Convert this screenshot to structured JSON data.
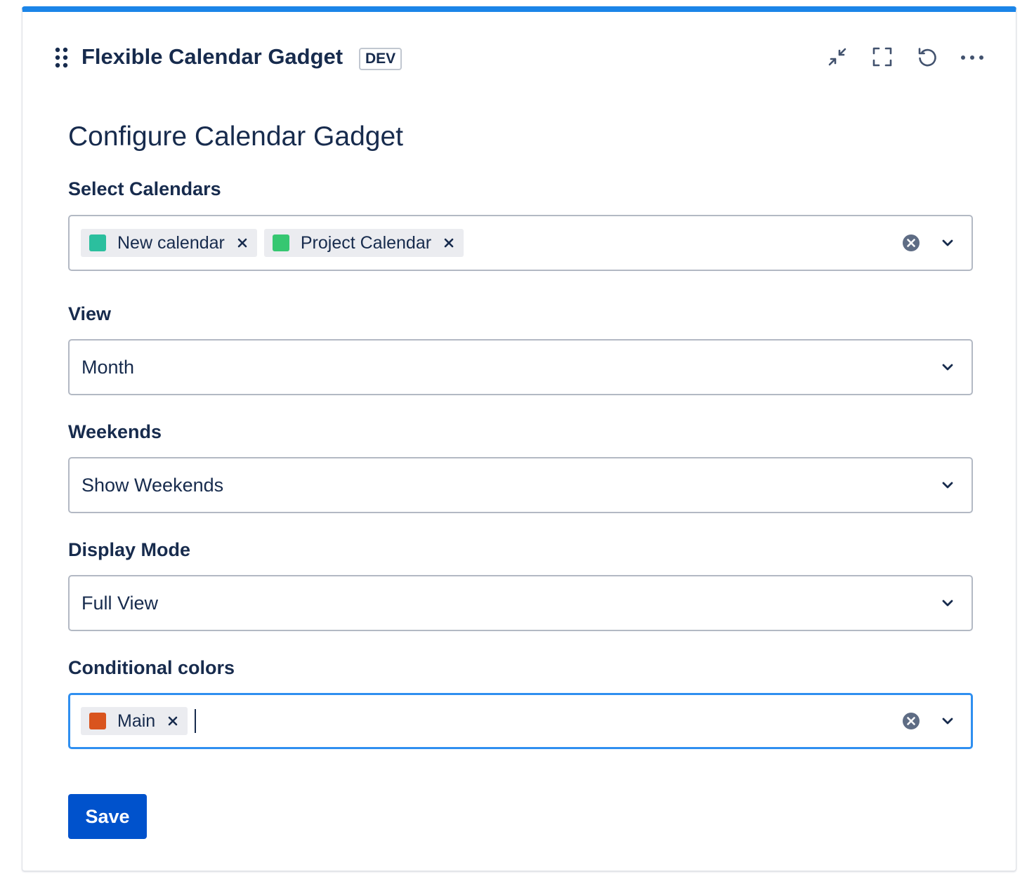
{
  "gadget": {
    "title": "Flexible Calendar Gadget",
    "badge": "DEV",
    "accent_color": "#1b85e8",
    "actions": [
      "minimize-icon",
      "fullscreen-icon",
      "refresh-icon",
      "more-icon"
    ]
  },
  "form": {
    "title": "Configure Calendar Gadget",
    "calendars": {
      "label": "Select Calendars",
      "selected": [
        {
          "label": "New calendar",
          "color": "#2bbf9e"
        },
        {
          "label": "Project Calendar",
          "color": "#36c771"
        }
      ]
    },
    "view": {
      "label": "View",
      "value": "Month"
    },
    "weekends": {
      "label": "Weekends",
      "value": "Show Weekends"
    },
    "display_mode": {
      "label": "Display Mode",
      "value": "Full View"
    },
    "conditional_colors": {
      "label": "Conditional colors",
      "selected": [
        {
          "label": "Main",
          "color": "#d9541e"
        }
      ]
    },
    "save_label": "Save",
    "save_color": "#0052cc"
  }
}
